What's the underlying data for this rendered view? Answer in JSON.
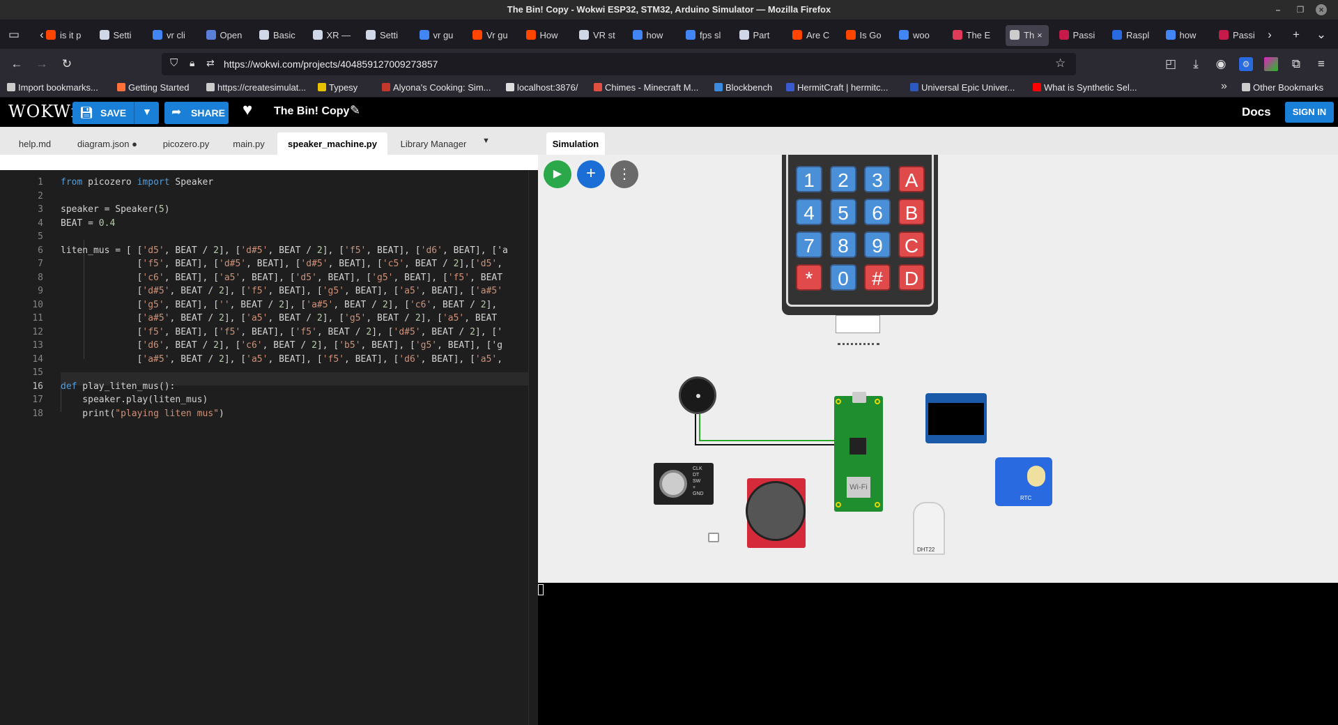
{
  "window": {
    "title": "The Bin! Copy - Wokwi ESP32, STM32, Arduino Simulator — Mozilla Firefox"
  },
  "browser_tabs": [
    {
      "label": "is it p",
      "color": "#ff4500"
    },
    {
      "label": "Setti",
      "color": "#d0d8e8"
    },
    {
      "label": "vr cli",
      "color": "#4285f4"
    },
    {
      "label": "Open",
      "color": "#5a7fd8"
    },
    {
      "label": "Basic",
      "color": "#d0d8e8"
    },
    {
      "label": "XR —",
      "color": "#d0d8e8"
    },
    {
      "label": "Setti",
      "color": "#d0d8e8"
    },
    {
      "label": "vr gu",
      "color": "#4285f4"
    },
    {
      "label": "Vr gu",
      "color": "#ff4500"
    },
    {
      "label": "How",
      "color": "#ff4500"
    },
    {
      "label": "VR st",
      "color": "#d0d8e8"
    },
    {
      "label": "how",
      "color": "#4285f4"
    },
    {
      "label": "fps sl",
      "color": "#4285f4"
    },
    {
      "label": "Part",
      "color": "#d0d8e8"
    },
    {
      "label": "Are C",
      "color": "#ff4500"
    },
    {
      "label": "Is Go",
      "color": "#ff4500"
    },
    {
      "label": "woo",
      "color": "#4285f4"
    },
    {
      "label": "The E",
      "color": "#e03a5a"
    },
    {
      "label": "Th",
      "color": "#cccccc"
    },
    {
      "label": "Passi",
      "color": "#c51a4a"
    },
    {
      "label": "Raspl",
      "color": "#2a6ae0"
    },
    {
      "label": "how",
      "color": "#4285f4"
    },
    {
      "label": "Passi",
      "color": "#c51a4a"
    }
  ],
  "address": {
    "url": "https://wokwi.com/projects/404859127009273857"
  },
  "bookmarks": [
    {
      "label": "Import bookmarks...",
      "color": "#cccccc"
    },
    {
      "label": "Getting Started",
      "color": "#ff7139"
    },
    {
      "label": "https://createsimulat...",
      "color": "#cccccc"
    },
    {
      "label": "Typesy",
      "color": "#e6c200"
    },
    {
      "label": "Alyona's Cooking: Sim...",
      "color": "#c0392b"
    },
    {
      "label": "localhost:3876/",
      "color": "#dddddd"
    },
    {
      "label": "Chimes - Minecraft M...",
      "color": "#e05040"
    },
    {
      "label": "Blockbench",
      "color": "#3a8ae0"
    },
    {
      "label": "HermitCraft | hermitc...",
      "color": "#3a5ad0"
    },
    {
      "label": "Universal Epic Univer...",
      "color": "#2a5ac0"
    },
    {
      "label": "What is Synthetic Sel...",
      "color": "#ff0000"
    },
    {
      "label": "Other Bookmarks",
      "color": "#cccccc"
    }
  ],
  "wokwi": {
    "logo": "WOKWi",
    "save": "SAVE",
    "share": "SHARE",
    "project_title": "The Bin! Copy",
    "docs": "Docs",
    "sign_in": "SIGN IN"
  },
  "editor_tabs": [
    {
      "label": "help.md"
    },
    {
      "label": "diagram.json ●"
    },
    {
      "label": "picozero.py"
    },
    {
      "label": "main.py"
    },
    {
      "label": "speaker_machine.py"
    },
    {
      "label": "Library Manager"
    }
  ],
  "code_lines": [
    "from picozero import Speaker",
    "",
    "speaker = Speaker(5)",
    "BEAT = 0.4",
    "",
    "liten_mus = [ ['d5', BEAT / 2], ['d#5', BEAT / 2], ['f5', BEAT], ['d6', BEAT], ['a",
    "              ['f5', BEAT], ['d#5', BEAT], ['d#5', BEAT], ['c5', BEAT / 2],['d5',",
    "              ['c6', BEAT], ['a5', BEAT], ['d5', BEAT], ['g5', BEAT], ['f5', BEAT",
    "              ['d#5', BEAT / 2], ['f5', BEAT], ['g5', BEAT], ['a5', BEAT], ['a#5'",
    "              ['g5', BEAT], ['', BEAT / 2], ['a#5', BEAT / 2], ['c6', BEAT / 2],",
    "              ['a#5', BEAT / 2], ['a5', BEAT / 2], ['g5', BEAT / 2], ['a5', BEAT",
    "              ['f5', BEAT], ['f5', BEAT], ['f5', BEAT / 2], ['d#5', BEAT / 2], ['",
    "              ['d6', BEAT / 2], ['c6', BEAT / 2], ['b5', BEAT], ['g5', BEAT], ['g",
    "              ['a#5', BEAT / 2], ['a5', BEAT], ['f5', BEAT], ['d6', BEAT], ['a5',",
    "",
    "def play_liten_mus():",
    "    speaker.play(liten_mus)",
    "    print(\"playing liten mus\")"
  ],
  "line_numbers": [
    "1",
    "2",
    "3",
    "4",
    "5",
    "6",
    "7",
    "8",
    "9",
    "10",
    "11",
    "12",
    "13",
    "14",
    "15",
    "16",
    "17",
    "18"
  ],
  "sim": {
    "tab": "Simulation"
  },
  "keypad": [
    "1",
    "2",
    "3",
    "A",
    "4",
    "5",
    "6",
    "B",
    "7",
    "8",
    "9",
    "C",
    "*",
    "0",
    "#",
    "D"
  ],
  "components": {
    "dht_label": "DHT22",
    "pico_wifi": "Wi-Fi",
    "encoder_pins": [
      "CLK",
      "DT",
      "SW",
      "+",
      "GND"
    ],
    "rtc_label": "RTC"
  }
}
